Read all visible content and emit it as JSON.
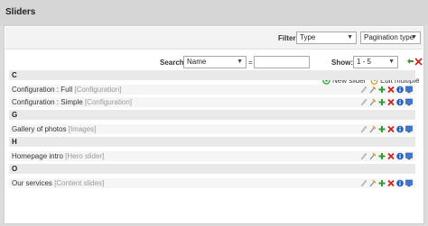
{
  "page": {
    "title": "Sliders"
  },
  "filter": {
    "label": "Filter:",
    "type_value": "Type",
    "pagination_value": "Pagination type"
  },
  "search": {
    "label": "Search:",
    "field_value": "Name",
    "operator": "=",
    "input_value": ""
  },
  "show": {
    "label": "Show:",
    "value": "1 - 5"
  },
  "actions": {
    "new_slider": "New slider",
    "edit_multiple": "Edit multiple"
  },
  "groups": [
    {
      "letter": "C",
      "items": [
        {
          "name": "Configuration : Full",
          "type": "[Configuration]"
        },
        {
          "name": "Configuration : Simple",
          "type": "[Configuration]"
        }
      ]
    },
    {
      "letter": "G",
      "items": [
        {
          "name": "Gallery of photos",
          "type": "[Images]"
        }
      ]
    },
    {
      "letter": "H",
      "items": [
        {
          "name": "Homepage intro",
          "type": "[Hero slider]"
        }
      ]
    },
    {
      "letter": "O",
      "items": [
        {
          "name": "Our services",
          "type": "[Content slides]"
        }
      ]
    }
  ],
  "colors": {
    "add": "#2e9e2e",
    "delete": "#d02020",
    "info": "#2060c0",
    "preview": "#3a78d8",
    "new_icon": "#3aa63a",
    "edit_icon": "#e0a020"
  },
  "icons": {
    "row": [
      "edit-pencil-icon",
      "tools-icon",
      "add-icon",
      "delete-icon",
      "info-icon",
      "preview-icon"
    ]
  }
}
